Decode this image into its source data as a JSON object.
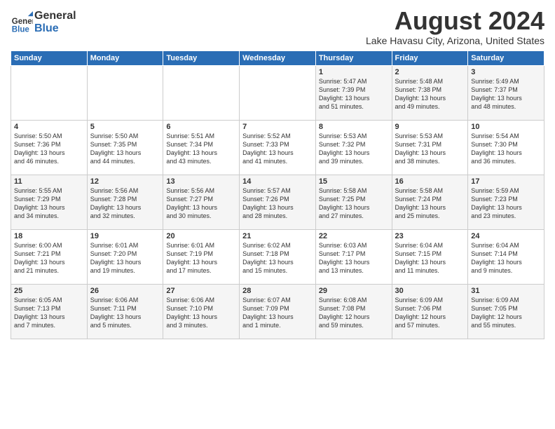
{
  "logo": {
    "general": "General",
    "blue": "Blue"
  },
  "header": {
    "month_year": "August 2024",
    "location": "Lake Havasu City, Arizona, United States"
  },
  "days_of_week": [
    "Sunday",
    "Monday",
    "Tuesday",
    "Wednesday",
    "Thursday",
    "Friday",
    "Saturday"
  ],
  "weeks": [
    [
      {
        "day": "",
        "info": ""
      },
      {
        "day": "",
        "info": ""
      },
      {
        "day": "",
        "info": ""
      },
      {
        "day": "",
        "info": ""
      },
      {
        "day": "1",
        "info": "Sunrise: 5:47 AM\nSunset: 7:39 PM\nDaylight: 13 hours\nand 51 minutes."
      },
      {
        "day": "2",
        "info": "Sunrise: 5:48 AM\nSunset: 7:38 PM\nDaylight: 13 hours\nand 49 minutes."
      },
      {
        "day": "3",
        "info": "Sunrise: 5:49 AM\nSunset: 7:37 PM\nDaylight: 13 hours\nand 48 minutes."
      }
    ],
    [
      {
        "day": "4",
        "info": "Sunrise: 5:50 AM\nSunset: 7:36 PM\nDaylight: 13 hours\nand 46 minutes."
      },
      {
        "day": "5",
        "info": "Sunrise: 5:50 AM\nSunset: 7:35 PM\nDaylight: 13 hours\nand 44 minutes."
      },
      {
        "day": "6",
        "info": "Sunrise: 5:51 AM\nSunset: 7:34 PM\nDaylight: 13 hours\nand 43 minutes."
      },
      {
        "day": "7",
        "info": "Sunrise: 5:52 AM\nSunset: 7:33 PM\nDaylight: 13 hours\nand 41 minutes."
      },
      {
        "day": "8",
        "info": "Sunrise: 5:53 AM\nSunset: 7:32 PM\nDaylight: 13 hours\nand 39 minutes."
      },
      {
        "day": "9",
        "info": "Sunrise: 5:53 AM\nSunset: 7:31 PM\nDaylight: 13 hours\nand 38 minutes."
      },
      {
        "day": "10",
        "info": "Sunrise: 5:54 AM\nSunset: 7:30 PM\nDaylight: 13 hours\nand 36 minutes."
      }
    ],
    [
      {
        "day": "11",
        "info": "Sunrise: 5:55 AM\nSunset: 7:29 PM\nDaylight: 13 hours\nand 34 minutes."
      },
      {
        "day": "12",
        "info": "Sunrise: 5:56 AM\nSunset: 7:28 PM\nDaylight: 13 hours\nand 32 minutes."
      },
      {
        "day": "13",
        "info": "Sunrise: 5:56 AM\nSunset: 7:27 PM\nDaylight: 13 hours\nand 30 minutes."
      },
      {
        "day": "14",
        "info": "Sunrise: 5:57 AM\nSunset: 7:26 PM\nDaylight: 13 hours\nand 28 minutes."
      },
      {
        "day": "15",
        "info": "Sunrise: 5:58 AM\nSunset: 7:25 PM\nDaylight: 13 hours\nand 27 minutes."
      },
      {
        "day": "16",
        "info": "Sunrise: 5:58 AM\nSunset: 7:24 PM\nDaylight: 13 hours\nand 25 minutes."
      },
      {
        "day": "17",
        "info": "Sunrise: 5:59 AM\nSunset: 7:23 PM\nDaylight: 13 hours\nand 23 minutes."
      }
    ],
    [
      {
        "day": "18",
        "info": "Sunrise: 6:00 AM\nSunset: 7:21 PM\nDaylight: 13 hours\nand 21 minutes."
      },
      {
        "day": "19",
        "info": "Sunrise: 6:01 AM\nSunset: 7:20 PM\nDaylight: 13 hours\nand 19 minutes."
      },
      {
        "day": "20",
        "info": "Sunrise: 6:01 AM\nSunset: 7:19 PM\nDaylight: 13 hours\nand 17 minutes."
      },
      {
        "day": "21",
        "info": "Sunrise: 6:02 AM\nSunset: 7:18 PM\nDaylight: 13 hours\nand 15 minutes."
      },
      {
        "day": "22",
        "info": "Sunrise: 6:03 AM\nSunset: 7:17 PM\nDaylight: 13 hours\nand 13 minutes."
      },
      {
        "day": "23",
        "info": "Sunrise: 6:04 AM\nSunset: 7:15 PM\nDaylight: 13 hours\nand 11 minutes."
      },
      {
        "day": "24",
        "info": "Sunrise: 6:04 AM\nSunset: 7:14 PM\nDaylight: 13 hours\nand 9 minutes."
      }
    ],
    [
      {
        "day": "25",
        "info": "Sunrise: 6:05 AM\nSunset: 7:13 PM\nDaylight: 13 hours\nand 7 minutes."
      },
      {
        "day": "26",
        "info": "Sunrise: 6:06 AM\nSunset: 7:11 PM\nDaylight: 13 hours\nand 5 minutes."
      },
      {
        "day": "27",
        "info": "Sunrise: 6:06 AM\nSunset: 7:10 PM\nDaylight: 13 hours\nand 3 minutes."
      },
      {
        "day": "28",
        "info": "Sunrise: 6:07 AM\nSunset: 7:09 PM\nDaylight: 13 hours\nand 1 minute."
      },
      {
        "day": "29",
        "info": "Sunrise: 6:08 AM\nSunset: 7:08 PM\nDaylight: 12 hours\nand 59 minutes."
      },
      {
        "day": "30",
        "info": "Sunrise: 6:09 AM\nSunset: 7:06 PM\nDaylight: 12 hours\nand 57 minutes."
      },
      {
        "day": "31",
        "info": "Sunrise: 6:09 AM\nSunset: 7:05 PM\nDaylight: 12 hours\nand 55 minutes."
      }
    ]
  ]
}
